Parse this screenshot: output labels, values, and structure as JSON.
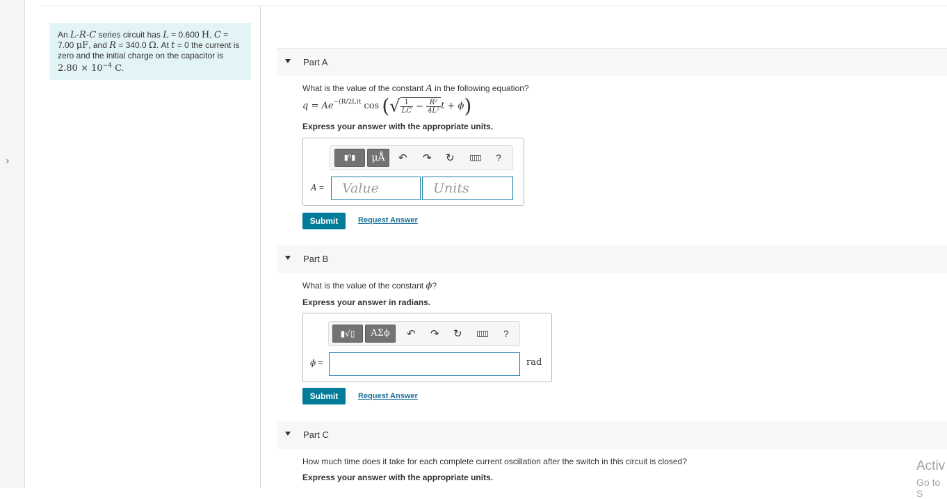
{
  "sidebar": {
    "toggle_glyph": "›",
    "toggle_icon": "chevron-right-icon"
  },
  "problem": {
    "p1": "An ",
    "lrc": "L-R-C",
    "p2": " series circuit has ",
    "L_sym": "L",
    "L_val": " = 0.600 ",
    "L_unit": "H",
    "C_sym": "C",
    "C_val": " = 7.00 ",
    "C_unit": "μF",
    "p3": ", and ",
    "R_sym": "R",
    "R_val": " = 340.0 ",
    "R_unit": "Ω",
    "p4": ". At ",
    "t_sym": "t",
    "p5": " = 0 the current is zero and the initial charge on the capacitor is ",
    "q0": "2.80 × 10",
    "q0_exp": "−4",
    "q0_unit": " C",
    "p6": "."
  },
  "partA": {
    "title": "Part A",
    "question_pre": "What is the value of the constant ",
    "question_sym": "A",
    "question_post": " in the following equation?",
    "eq": {
      "lhs": "q",
      "eq_sign": " = ",
      "A": "A",
      "e": "e",
      "exp": "−(R/2L)t",
      "cos": " cos ",
      "f1_num": "1",
      "f1_den": "LC",
      "minus": " − ",
      "f2_num": "R²",
      "f2_den": "4L²",
      "tail": "t + ϕ"
    },
    "instruction": "Express your answer with the appropriate units.",
    "toolbar": {
      "templates": "▮⁰▮",
      "units": "μÅ",
      "undo": "↶",
      "redo": "↷",
      "reset": "↻",
      "help": "?"
    },
    "label_sym": "A",
    "label_eq": " =",
    "value_placeholder": "Value",
    "units_placeholder": "Units",
    "submit": "Submit",
    "request": "Request Answer"
  },
  "partB": {
    "title": "Part B",
    "question_pre": "What is the value of the constant ",
    "question_sym": "ϕ",
    "question_post": "?",
    "instruction": "Express your answer in radians.",
    "toolbar": {
      "templates": "▮√▯",
      "symbols": "ΑΣϕ",
      "undo": "↶",
      "redo": "↷",
      "reset": "↻",
      "help": "?"
    },
    "label_sym": "ϕ",
    "label_eq": " =",
    "value": "",
    "unit": "rad",
    "submit": "Submit",
    "request": "Request Answer"
  },
  "partC": {
    "title": "Part C",
    "question": "How much time does it take for each complete current oscillation after the switch in this circuit is closed?",
    "instruction": "Express your answer with the appropriate units."
  },
  "watermark": {
    "line1": "Activ",
    "line2": "Go to S"
  }
}
